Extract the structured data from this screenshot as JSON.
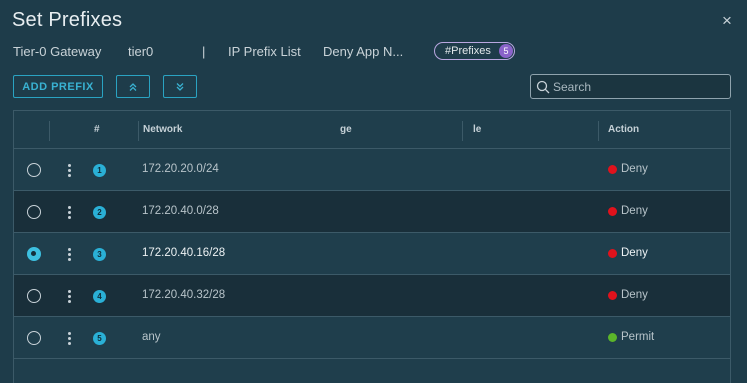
{
  "dialog": {
    "title": "Set Prefixes",
    "close_glyph": "×"
  },
  "context": {
    "gateway_type": "Tier-0 Gateway",
    "gateway_name": "tier0",
    "divider": "|",
    "list_type": "IP Prefix List",
    "list_name": "Deny App N...",
    "prefix_badge_label": "#Prefixes",
    "prefix_count": "5"
  },
  "toolbar": {
    "add_label": "ADD PREFIX",
    "move_up_icon": "chevrons-up-icon",
    "move_down_icon": "chevrons-down-icon"
  },
  "search": {
    "placeholder": "Search",
    "value": ""
  },
  "table": {
    "columns": {
      "number": "#",
      "network": "Network",
      "ge": "ge",
      "le": "le",
      "action": "Action"
    },
    "rows": [
      {
        "index": "1",
        "network": "172.20.20.0/24",
        "ge": "",
        "le": "",
        "action": "Deny",
        "action_color": "#e0121c",
        "selected": false
      },
      {
        "index": "2",
        "network": "172.20.40.0/28",
        "ge": "",
        "le": "",
        "action": "Deny",
        "action_color": "#e0121c",
        "selected": false
      },
      {
        "index": "3",
        "network": "172.20.40.16/28",
        "ge": "",
        "le": "",
        "action": "Deny",
        "action_color": "#e0121c",
        "selected": true
      },
      {
        "index": "4",
        "network": "172.20.40.32/28",
        "ge": "",
        "le": "",
        "action": "Deny",
        "action_color": "#e0121c",
        "selected": false
      },
      {
        "index": "5",
        "network": "any",
        "ge": "",
        "le": "",
        "action": "Permit",
        "action_color": "#5bb52a",
        "selected": false
      }
    ]
  },
  "colors": {
    "accent": "#39b2d2",
    "badge": "#8a63c9",
    "deny": "#e0121c",
    "permit": "#5bb52a"
  }
}
